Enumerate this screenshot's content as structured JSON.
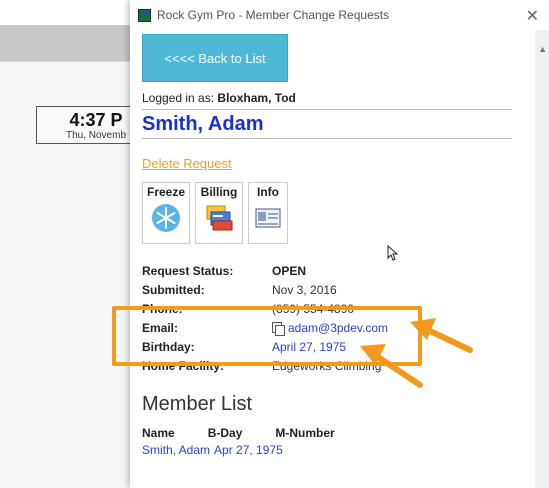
{
  "background": {
    "clock_time": "4:37 P",
    "clock_date": "Thu, Novemb"
  },
  "window": {
    "title": "Rock Gym Pro - Member Change Requests",
    "close_glyph": "✕"
  },
  "toolbar": {
    "back_label": "<<<< Back to List"
  },
  "session": {
    "logged_prefix": "Logged in as:",
    "user": "Bloxham, Tod"
  },
  "member": {
    "name": "Smith, Adam",
    "delete_label": "Delete Request"
  },
  "tiles": [
    {
      "label": "Freeze",
      "icon": "snowflake-icon"
    },
    {
      "label": "Billing",
      "icon": "billing-cards-icon"
    },
    {
      "label": "Info",
      "icon": "id-card-icon"
    }
  ],
  "details": {
    "status_label": "Request Status:",
    "status_value": "OPEN",
    "submitted_label": "Submitted:",
    "submitted_value": "Nov 3, 2016",
    "phone_label": "Phone:",
    "phone_value": "(859) 554-4890",
    "email_label": "Email:",
    "email_value": "adam@3pdev.com",
    "birthday_label": "Birthday:",
    "birthday_value": "April 27, 1975",
    "facility_label": "Home Facility:",
    "facility_value": "Edgeworks Climbing"
  },
  "member_list": {
    "title": "Member List",
    "col_name": "Name",
    "col_bday": "B-Day",
    "col_mnum": "M-Number",
    "rows": [
      {
        "name": "Smith, Adam",
        "bday": "Apr 27, 1975",
        "mnum": ""
      }
    ]
  },
  "colors": {
    "highlight": "#f39a1c",
    "accent_button": "#4fb8d8",
    "name_blue": "#1c2fd1",
    "delete_orange": "#f0a030"
  }
}
